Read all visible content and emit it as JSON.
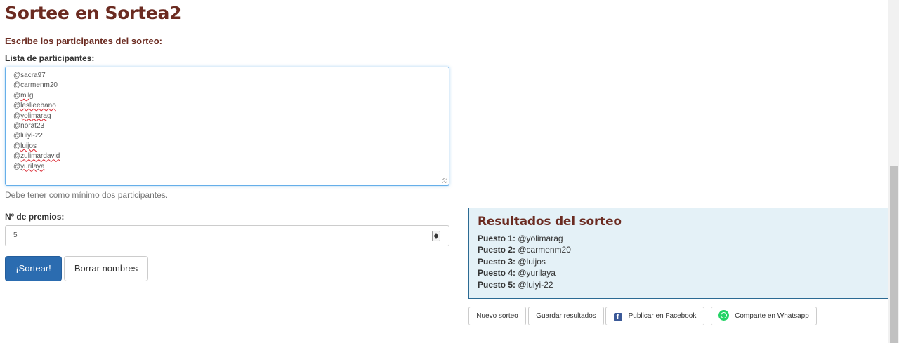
{
  "page": {
    "title": "Sortee en Sortea2",
    "subtitle": "Escribe los participantes del sorteo:"
  },
  "participants": {
    "label": "Lista de participantes:",
    "items": [
      {
        "text": "@sacra97",
        "spellcheck": false
      },
      {
        "text": "@carmenm20",
        "spellcheck": false
      },
      {
        "text": "@mllg",
        "spellcheck": true
      },
      {
        "text": "@leslieebano",
        "spellcheck": true
      },
      {
        "text": "@yolimarag",
        "spellcheck": true
      },
      {
        "text": "@norat23",
        "spellcheck": false
      },
      {
        "text": "@luiyi-22",
        "spellcheck": false
      },
      {
        "text": "@luijos",
        "spellcheck": true
      },
      {
        "text": "@zulimardavid",
        "spellcheck": true
      },
      {
        "text": "@yurilaya",
        "spellcheck": true
      }
    ],
    "hint": "Debe tener como mínimo dos participantes."
  },
  "prizes": {
    "label": "Nº de premios:",
    "value": "5"
  },
  "actions": {
    "draw_label": "¡Sortear!",
    "clear_label": "Borrar nombres"
  },
  "results": {
    "title": "Resultados del sorteo",
    "rows": [
      {
        "rank": "Puesto 1:",
        "name": "@yolimarag"
      },
      {
        "rank": "Puesto 2:",
        "name": "@carmenm20"
      },
      {
        "rank": "Puesto 3:",
        "name": "@luijos"
      },
      {
        "rank": "Puesto 4:",
        "name": "@yurilaya"
      },
      {
        "rank": "Puesto 5:",
        "name": "@luiyi-22"
      }
    ]
  },
  "result_actions": {
    "new_label": "Nuevo sorteo",
    "save_label": "Guardar resultados",
    "facebook_label": "Publicar en Facebook",
    "whatsapp_label": "Comparte en Whatsapp"
  },
  "colors": {
    "title": "#6b2b21",
    "primary_button": "#2b6cb0",
    "results_bg": "#e4f1f7",
    "results_border": "#2b6a93",
    "facebook": "#3b5998",
    "whatsapp": "#25d366"
  },
  "icons": {
    "facebook": "facebook-icon",
    "whatsapp": "whatsapp-icon"
  }
}
